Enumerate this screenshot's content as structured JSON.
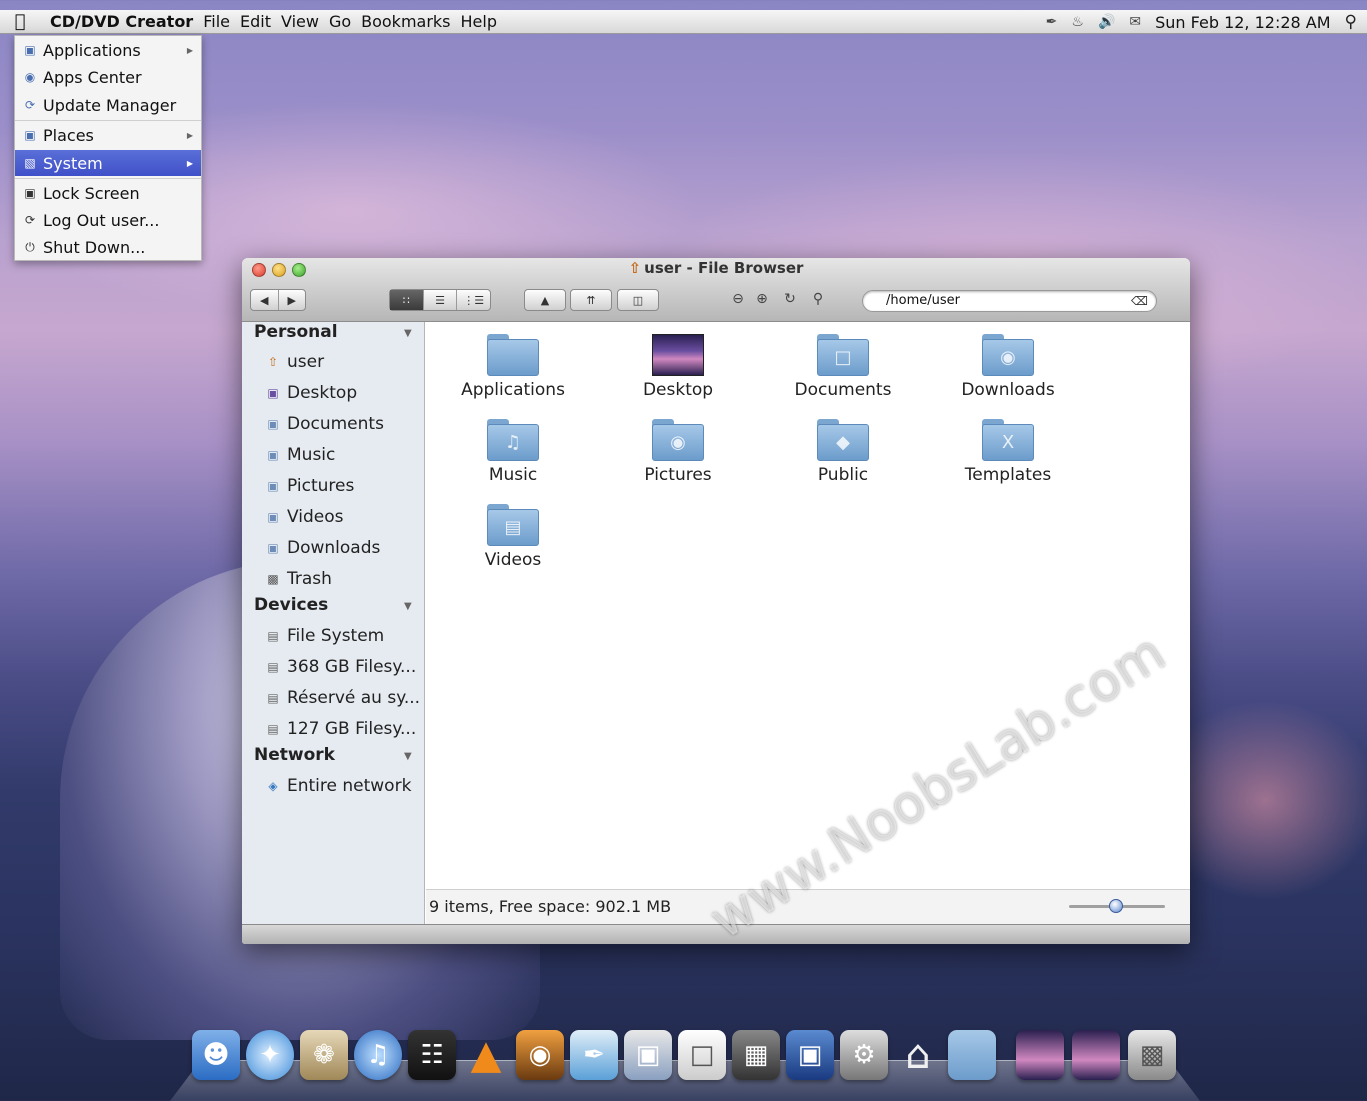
{
  "menubar": {
    "app_name": "CD/DVD Creator",
    "menus": [
      "File",
      "Edit",
      "View",
      "Go",
      "Bookmarks",
      "Help"
    ],
    "clock": "Sun Feb 12, 12:28 AM"
  },
  "system_menu": {
    "items": [
      {
        "label": "Applications",
        "icon": "folder-icon",
        "submenu": true
      },
      {
        "label": "Apps Center",
        "icon": "globe-icon",
        "submenu": false
      },
      {
        "label": "Update Manager",
        "icon": "update-icon",
        "submenu": false
      },
      {
        "label": "Places",
        "icon": "folder-icon",
        "submenu": true
      },
      {
        "label": "System",
        "icon": "monitor-icon",
        "submenu": true,
        "active": true
      },
      {
        "label": "Lock Screen",
        "icon": "lock-icon",
        "submenu": false
      },
      {
        "label": "Log Out user...",
        "icon": "logout-icon",
        "submenu": false
      },
      {
        "label": "Shut Down...",
        "icon": "power-icon",
        "submenu": false
      }
    ]
  },
  "window": {
    "title": "user - File Browser",
    "location": "/home/user"
  },
  "sidebar": {
    "personal": {
      "heading": "Personal",
      "items": [
        "user",
        "Desktop",
        "Documents",
        "Music",
        "Pictures",
        "Videos",
        "Downloads",
        "Trash"
      ]
    },
    "devices": {
      "heading": "Devices",
      "items": [
        "File System",
        "368 GB Filesy...",
        "Réservé au sy...",
        "127 GB Filesy..."
      ]
    },
    "network": {
      "heading": "Network",
      "items": [
        "Entire network"
      ]
    }
  },
  "files": [
    "Applications",
    "Desktop",
    "Documents",
    "Downloads",
    "Music",
    "Pictures",
    "Public",
    "Templates",
    "Videos"
  ],
  "status": {
    "text": "9 items, Free space: 902.1 MB"
  },
  "watermark": "www.NoobsLab.com",
  "colors": {
    "menu_highlight": "#4a5cd0",
    "folder_blue": "#8fb6dd"
  }
}
